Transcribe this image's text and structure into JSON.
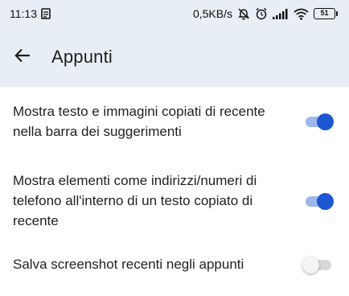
{
  "status_bar": {
    "time": "11:13",
    "net_speed": "0,5KB/s",
    "battery": "51",
    "icons": [
      "notes-icon",
      "mute-icon",
      "alarm-icon",
      "signal-icon",
      "wifi-icon",
      "battery-icon"
    ]
  },
  "app_bar": {
    "title": "Appunti",
    "back_icon": "arrow-back-icon",
    "background": "#e8eef5"
  },
  "settings": [
    {
      "label": "Mostra testo e immagini copiati di recente nella barra dei suggerimenti",
      "enabled": true
    },
    {
      "label": "Mostra elementi come indirizzi/numeri di telefono all'interno di un testo copiato di recente",
      "enabled": true
    },
    {
      "label": "Salva screenshot recenti negli appunti",
      "enabled": false
    }
  ],
  "colors": {
    "toggle_on_thumb": "#1b57d2",
    "toggle_on_track": "#9fb6e8",
    "toggle_off_track": "#d8d8d8"
  }
}
